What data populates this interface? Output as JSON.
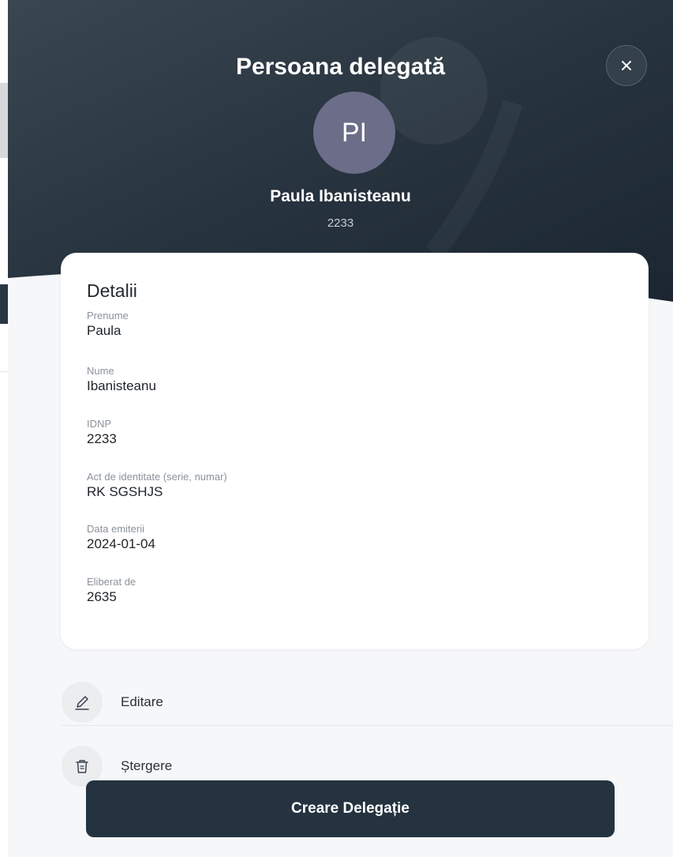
{
  "colors": {
    "header_dark": "#1e2a35",
    "header_light": "#3a4650",
    "avatar_bg": "#6b6d89",
    "panel_bg": "#f6f7f8",
    "primary_button": "#253340"
  },
  "header": {
    "title": "Persoana delegată",
    "close_icon": "close-icon"
  },
  "person": {
    "initials": "PI",
    "full_name": "Paula Ibanisteanu",
    "id": "2233"
  },
  "details": {
    "title": "Detalii",
    "fields": [
      {
        "label": "Prenume",
        "value": "Paula"
      },
      {
        "label": "Nume",
        "value": "Ibanisteanu"
      },
      {
        "label": "IDNP",
        "value": "2233"
      },
      {
        "label": "Act de identitate (serie, numar)",
        "value": "RK SGSHJS"
      },
      {
        "label": "Data emiterii",
        "value": "2024-01-04"
      },
      {
        "label": "Eliberat de",
        "value": "2635"
      }
    ]
  },
  "actions": [
    {
      "label": "Editare",
      "icon": "pencil-icon"
    },
    {
      "label": "Ștergere",
      "icon": "trash-icon"
    }
  ],
  "primary_button": {
    "label": "Creare Delegație"
  }
}
